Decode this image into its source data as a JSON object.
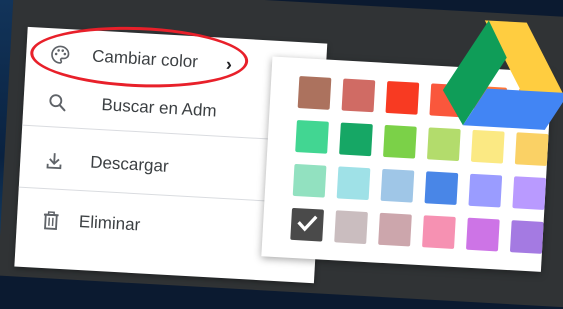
{
  "menu": {
    "items": [
      {
        "label": "Cambiar color",
        "icon": "palette-icon",
        "has_submenu": true
      },
      {
        "label": "Buscar en Adm",
        "icon": "search-icon"
      },
      {
        "label": "Descargar",
        "icon": "download-icon"
      },
      {
        "label": "Eliminar",
        "icon": "trash-icon"
      }
    ],
    "submenu_chevron": "›"
  },
  "palette": {
    "rows": [
      [
        "#ac725e",
        "#d06b64",
        "#f83a22",
        "#fa573c",
        "#ff7537",
        "#ffad46"
      ],
      [
        "#42d692",
        "#16a765",
        "#7bd148",
        "#b3dc6c",
        "#fbe983",
        "#fad165"
      ],
      [
        "#92e1c0",
        "#9fe1e7",
        "#9fc6e7",
        "#4986e7",
        "#9a9cff",
        "#b99aff"
      ],
      [
        "#8f8f8f",
        "#cabdbf",
        "#cca6ac",
        "#f691b2",
        "#cd74e6",
        "#a47ae2"
      ]
    ],
    "selected": {
      "row": 3,
      "col": 0,
      "icon": "checkmark-icon"
    }
  },
  "logo": {
    "name": "google-drive-logo",
    "colors": [
      "#0f9d58",
      "#ffcd40",
      "#4285f4"
    ]
  },
  "annotation": {
    "color": "#e8202a"
  }
}
